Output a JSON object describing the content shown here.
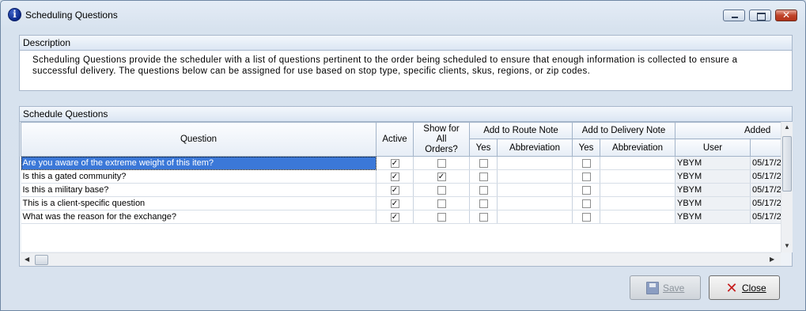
{
  "window": {
    "title": "Scheduling Questions",
    "minimize_glyph": "",
    "maximize_glyph": "",
    "close_glyph": "✕"
  },
  "description": {
    "header": "Description",
    "text": "Scheduling Questions provide the scheduler with a list of questions pertinent to the order being scheduled to ensure that enough information is collected to ensure a successful delivery.  The questions below can be assigned for use based on stop type, specific clients, skus, regions, or zip codes."
  },
  "questions_panel": {
    "header": "Schedule Questions",
    "columns": {
      "question": "Question",
      "active": "Active",
      "show_for_all": "Show for All Orders?",
      "route_note_group": "Add to Route Note",
      "route_yes": "Yes",
      "route_abbrev": "Abbreviation",
      "delivery_note_group": "Add to Delivery Note",
      "delivery_yes": "Yes",
      "delivery_abbrev": "Abbreviation",
      "added_group": "Added",
      "added_user": "User",
      "added_date": ""
    },
    "rows": [
      {
        "question": "Are you aware of the extreme weight of this item?",
        "active": true,
        "show_all": false,
        "route_yes": false,
        "route_abbrev": "",
        "delivery_yes": false,
        "delivery_abbrev": "",
        "user": "YBYM",
        "date": "05/17/2"
      },
      {
        "question": "Is this a gated community?",
        "active": true,
        "show_all": true,
        "route_yes": false,
        "route_abbrev": "",
        "delivery_yes": false,
        "delivery_abbrev": "",
        "user": "YBYM",
        "date": "05/17/2"
      },
      {
        "question": "Is this a military base?",
        "active": true,
        "show_all": false,
        "route_yes": false,
        "route_abbrev": "",
        "delivery_yes": false,
        "delivery_abbrev": "",
        "user": "YBYM",
        "date": "05/17/2"
      },
      {
        "question": "This is a client-specific question",
        "active": true,
        "show_all": false,
        "route_yes": false,
        "route_abbrev": "",
        "delivery_yes": false,
        "delivery_abbrev": "",
        "user": "YBYM",
        "date": "05/17/2"
      },
      {
        "question": "What was the reason for the exchange?",
        "active": true,
        "show_all": false,
        "route_yes": false,
        "route_abbrev": "",
        "delivery_yes": false,
        "delivery_abbrev": "",
        "user": "YBYM",
        "date": "05/17/2"
      }
    ],
    "selected_row": 0
  },
  "buttons": {
    "save_label": "Save",
    "save_enabled": false,
    "close_label": "Close"
  },
  "icons": {
    "app": "info-icon",
    "save": "floppy-disk-icon",
    "close": "red-x-icon"
  },
  "colors": {
    "selection": "#3b78d8",
    "window_bg": "#d7e2ee",
    "close_x": "#c61b1b"
  }
}
